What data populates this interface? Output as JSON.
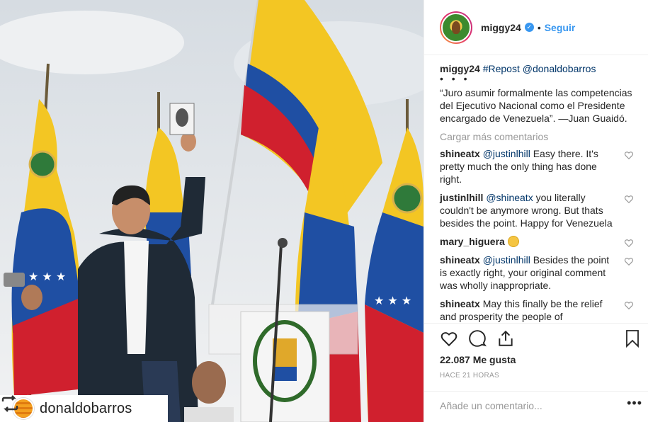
{
  "header": {
    "username": "miggy24",
    "separator": "•",
    "follow_label": "Seguir",
    "verified_glyph": "✓"
  },
  "caption": {
    "username": "miggy24",
    "hashtag": "#Repost",
    "mention": "@donaldobarros",
    "dots": "• • •",
    "text": "“Juro asumir formalmente las competencias del Ejecutivo Nacional como el Presidente encargado de Venezuela”. —Juan Guaidó."
  },
  "load_more": "Cargar más comentarios",
  "comments": [
    {
      "user": "shineatx",
      "mention": "@justinlhill",
      "text": " Easy there. It's pretty much the only thing has done right."
    },
    {
      "user": "justinlhill",
      "mention": "@shineatx",
      "text": " you literally couldn't be anymore wrong. But thats besides the point. Happy for Venezuela"
    },
    {
      "user": "mary_higuera",
      "mention": "",
      "text": ""
    },
    {
      "user": "shineatx",
      "mention": "@justinlhill",
      "text": " Besides the point is exactly right, your original comment was wholly inappropriate."
    },
    {
      "user": "shineatx",
      "mention": "",
      "text": "May this finally be the relief and prosperity the people of"
    }
  ],
  "likes": "22.087 Me gusta",
  "time": "HACE 21 HORAS",
  "add_comment_placeholder": "Añade un comentario...",
  "options_glyph": "•••",
  "repost_tag": {
    "username": "donaldobarros"
  },
  "colors": {
    "accent": "#3897f0",
    "text": "#262626",
    "muted": "#999999",
    "flag_yellow": "#f3c623",
    "flag_blue": "#1f4fa3",
    "flag_red": "#d0202e"
  },
  "icons": [
    "repost-icon",
    "heart-icon",
    "comment-icon",
    "share-icon",
    "bookmark-icon",
    "verified-icon"
  ]
}
